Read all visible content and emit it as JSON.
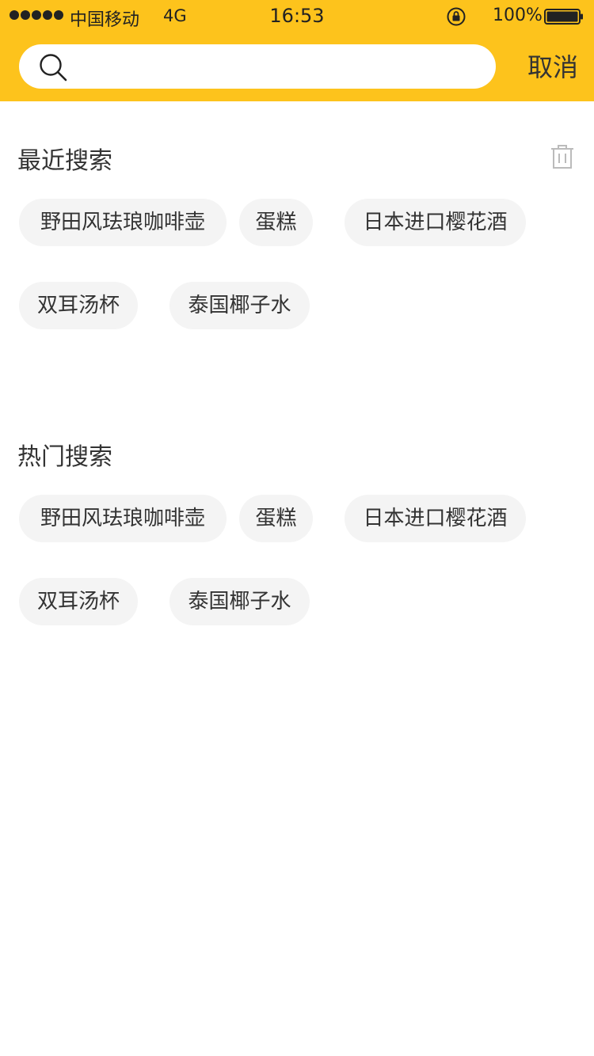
{
  "status_bar": {
    "carrier": "中国移动",
    "network": "4G",
    "time": "16:53",
    "battery_percent": "100%"
  },
  "search": {
    "placeholder": "",
    "value": "",
    "cancel_label": "取消"
  },
  "recent": {
    "title": "最近搜索",
    "tags": [
      "野田风珐琅咖啡壶",
      "蛋糕",
      "日本进口樱花酒",
      "双耳汤杯",
      "泰国椰子水"
    ]
  },
  "hot": {
    "title": "热门搜索",
    "tags": [
      "野田风珐琅咖啡壶",
      "蛋糕",
      "日本进口樱花酒",
      "双耳汤杯",
      "泰国椰子水"
    ]
  },
  "colors": {
    "accent": "#FDC31C",
    "tag_bg": "#F4F4F4",
    "text": "#333333"
  },
  "icons": {
    "search": "search-icon",
    "trash": "trash-icon",
    "lock": "orientation-lock-icon",
    "battery": "battery-icon"
  }
}
